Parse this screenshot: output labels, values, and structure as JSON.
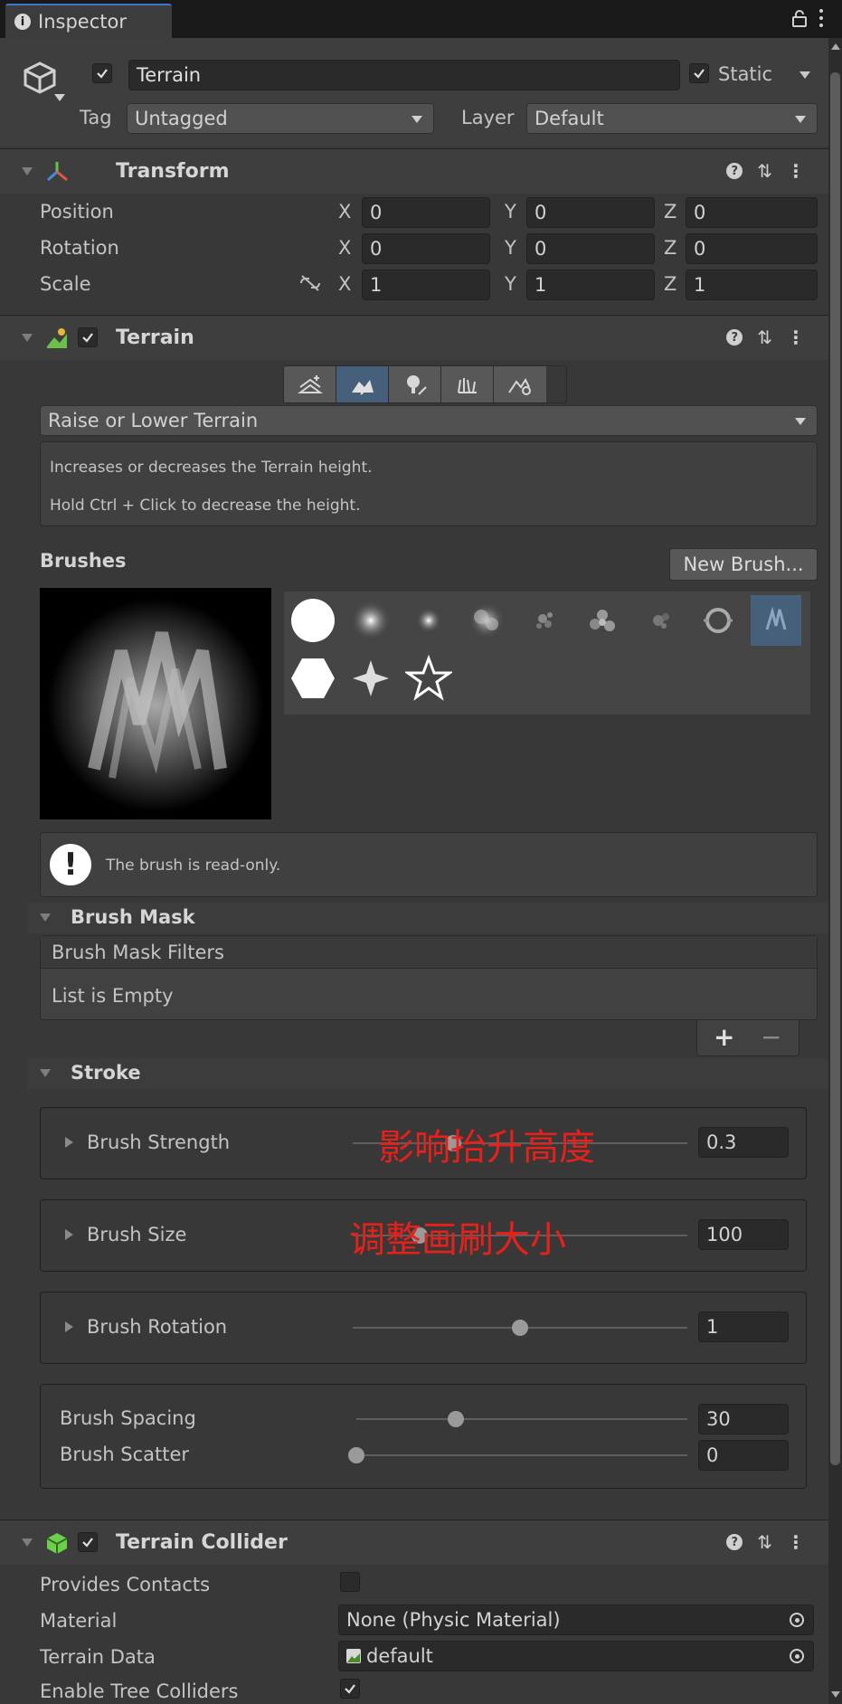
{
  "tab": {
    "title": "Inspector",
    "lock_icon": "lock-icon",
    "menu_icon": "kebab-icon"
  },
  "object": {
    "name": "Terrain",
    "static_label": "Static",
    "tag_label": "Tag",
    "tag_value": "Untagged",
    "layer_label": "Layer",
    "layer_value": "Default"
  },
  "transform": {
    "title": "Transform",
    "rows": [
      {
        "label": "Position",
        "x": "0",
        "y": "0",
        "z": "0"
      },
      {
        "label": "Rotation",
        "x": "0",
        "y": "0",
        "z": "0"
      },
      {
        "label": "Scale",
        "x": "1",
        "y": "1",
        "z": "1"
      }
    ],
    "axis_x": "X",
    "axis_y": "Y",
    "axis_z": "Z"
  },
  "terrain": {
    "title": "Terrain",
    "tool_dropdown": "Raise or Lower Terrain",
    "help_line1": "Increases or decreases the Terrain height.",
    "help_line2": "Hold Ctrl + Click to decrease the height.",
    "brushes_label": "Brushes",
    "new_brush_button": "New Brush...",
    "readonly_message": "The brush is read-only.",
    "brush_mask": {
      "title": "Brush Mask",
      "filters_header": "Brush Mask Filters",
      "empty_text": "List is Empty",
      "add": "+",
      "remove": "−"
    },
    "stroke": {
      "title": "Stroke",
      "strength": {
        "label": "Brush Strength",
        "value": "0.3",
        "annotation": "影响抬升高度",
        "fraction": 0.3
      },
      "size": {
        "label": "Brush Size",
        "value": "100",
        "annotation": "调整画刷大小",
        "fraction": 0.2
      },
      "rotation": {
        "label": "Brush Rotation",
        "value": "1",
        "fraction": 0.5
      },
      "spacing": {
        "label": "Brush Spacing",
        "value": "30",
        "fraction": 0.3
      },
      "scatter": {
        "label": "Brush Scatter",
        "value": "0",
        "fraction": 0.0
      }
    }
  },
  "collider": {
    "title": "Terrain Collider",
    "provides_contacts": "Provides Contacts",
    "material_label": "Material",
    "material_value": "None (Physic Material)",
    "terrain_data_label": "Terrain Data",
    "terrain_data_value": "default",
    "enable_trees_label": "Enable Tree Colliders"
  },
  "colors": {
    "accent_selected": "#46607c",
    "annotation_red": "#e6201a"
  }
}
